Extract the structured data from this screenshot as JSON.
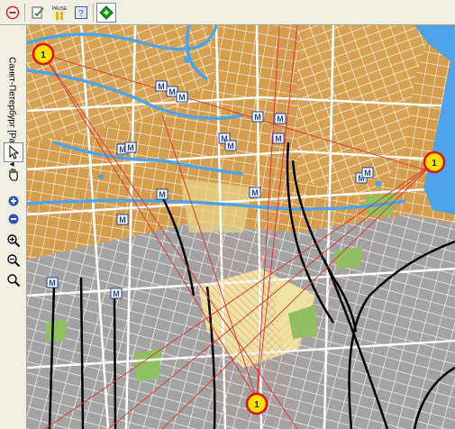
{
  "toolbar": {
    "buttons": [
      {
        "name": "stop-button",
        "icon": "stop-circle-icon"
      },
      {
        "name": "edit-button",
        "icon": "edit-document-icon"
      },
      {
        "name": "pause-button",
        "icon": "pause-icon",
        "label": "PAUSE"
      },
      {
        "name": "question-button",
        "icon": "help-document-icon"
      },
      {
        "name": "navigate-button",
        "icon": "green-diamond-icon"
      }
    ],
    "pause_label": "PAUSE"
  },
  "sidebar": {
    "map_title": "Санкт-Петербург [Растр] ▾",
    "tools": [
      "select-arrow-icon",
      "pan-hand-icon",
      "zoom-in-icon",
      "zoom-out-icon",
      "zoom-in-magnifier-icon",
      "zoom-out-magnifier-icon",
      "zoom-tool-icon"
    ]
  },
  "map": {
    "metro_label": "M",
    "marker_label": "1",
    "colors": {
      "water": "#4fa3e8",
      "building": "#d8a254",
      "industrial": "#9e9e9e",
      "park": "#8fc062",
      "road": "#ffffff",
      "railway": "#000000",
      "beam": "#e03030",
      "marker_ring": "#e01010",
      "marker_fill": "#ffe000",
      "metro_box": "#1f3f9a"
    },
    "metro_stations": [
      {
        "name": "metro-station-1"
      },
      {
        "name": "metro-station-2"
      },
      {
        "name": "metro-station-3"
      },
      {
        "name": "metro-station-4"
      },
      {
        "name": "metro-station-5"
      },
      {
        "name": "metro-station-6"
      },
      {
        "name": "metro-station-7"
      },
      {
        "name": "metro-station-8"
      },
      {
        "name": "metro-station-9"
      },
      {
        "name": "metro-station-10"
      },
      {
        "name": "metro-station-11"
      },
      {
        "name": "metro-station-12"
      },
      {
        "name": "metro-station-13"
      },
      {
        "name": "metro-station-14"
      },
      {
        "name": "metro-station-15"
      },
      {
        "name": "metro-station-16"
      },
      {
        "name": "metro-station-17"
      }
    ],
    "position_markers": [
      {
        "name": "position-marker-nw"
      },
      {
        "name": "position-marker-east"
      },
      {
        "name": "position-marker-south"
      }
    ]
  }
}
